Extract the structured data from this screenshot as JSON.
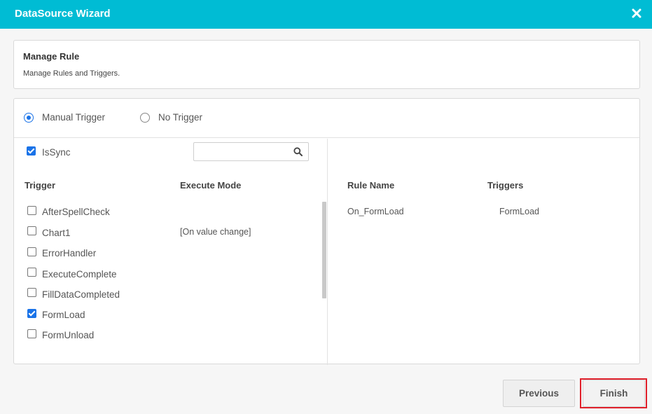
{
  "dialog": {
    "title": "DataSource Wizard",
    "close_icon": "close-icon"
  },
  "header": {
    "title": "Manage Rule",
    "subtitle": "Manage Rules and Triggers."
  },
  "trigger_mode": {
    "options": [
      {
        "label": "Manual Trigger",
        "selected": true
      },
      {
        "label": "No Trigger",
        "selected": false
      }
    ]
  },
  "issync": {
    "label": "IsSync",
    "checked": true
  },
  "search": {
    "placeholder": "",
    "value": "",
    "icon": "search-icon"
  },
  "trigger_table": {
    "columns": [
      "Trigger",
      "Execute Mode"
    ],
    "rows": [
      {
        "name": "AfterSpellCheck",
        "mode": "",
        "checked": false
      },
      {
        "name": "Chart1",
        "mode": "[On value change]",
        "checked": false
      },
      {
        "name": "ErrorHandler",
        "mode": "",
        "checked": false
      },
      {
        "name": "ExecuteComplete",
        "mode": "",
        "checked": false
      },
      {
        "name": "FillDataCompleted",
        "mode": "",
        "checked": false
      },
      {
        "name": "FormLoad",
        "mode": "",
        "checked": true
      },
      {
        "name": "FormUnload",
        "mode": "",
        "checked": false
      }
    ]
  },
  "rule_table": {
    "columns": [
      "Rule Name",
      "Triggers"
    ],
    "rows": [
      {
        "rule": "On_FormLoad",
        "triggers": "FormLoad"
      }
    ]
  },
  "footer": {
    "previous_label": "Previous",
    "finish_label": "Finish"
  },
  "colors": {
    "titlebar": "#00bcd4",
    "accent": "#1a73e8",
    "highlight": "#e0202b"
  }
}
